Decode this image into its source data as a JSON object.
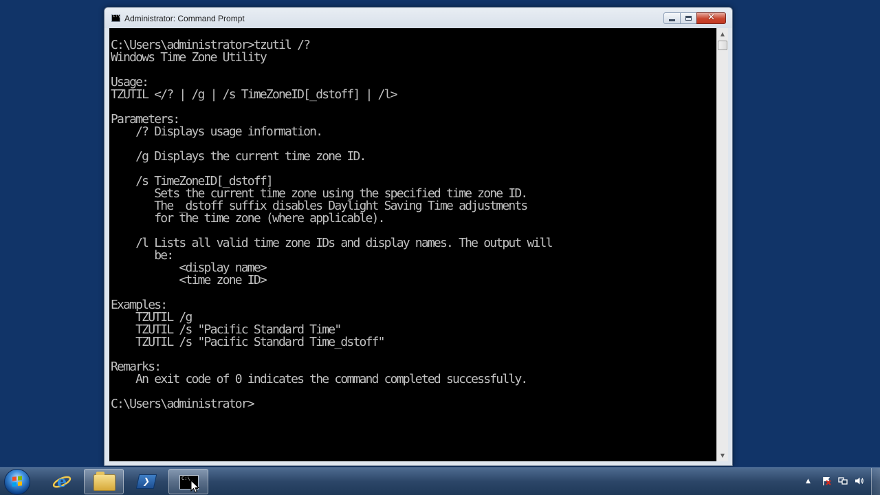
{
  "window": {
    "title": "Administrator: Command Prompt",
    "icon": "cmd-icon",
    "close_glyph": "✕"
  },
  "console": {
    "lines": [
      "C:\\Users\\administrator>tzutil /?",
      "Windows Time Zone Utility",
      "",
      "Usage:",
      "TZUTIL </? | /g | /s TimeZoneID[_dstoff] | /l>",
      "",
      "Parameters:",
      "    /? Displays usage information.",
      "",
      "    /g Displays the current time zone ID.",
      "",
      "    /s TimeZoneID[_dstoff]",
      "       Sets the current time zone using the specified time zone ID.",
      "       The _dstoff suffix disables Daylight Saving Time adjustments",
      "       for the time zone (where applicable).",
      "",
      "    /l Lists all valid time zone IDs and display names. The output will",
      "       be:",
      "           <display name>",
      "           <time zone ID>",
      "",
      "Examples:",
      "    TZUTIL /g",
      "    TZUTIL /s \"Pacific Standard Time\"",
      "    TZUTIL /s \"Pacific Standard Time_dstoff\"",
      "",
      "Remarks:",
      "    An exit code of 0 indicates the command completed successfully.",
      "",
      "C:\\Users\\administrator>"
    ]
  },
  "scrollbar": {
    "up_arrow": "▲",
    "down_arrow": "▼"
  },
  "taskbar": {
    "items": [
      {
        "icon": "start-orb-icon"
      },
      {
        "icon": "internet-explorer-icon"
      },
      {
        "icon": "file-explorer-icon"
      },
      {
        "icon": "powershell-icon",
        "glyph": "❯"
      },
      {
        "icon": "command-prompt-icon",
        "active": true
      }
    ],
    "tray": {
      "arrow": "▲",
      "icons": [
        "action-center-flag-icon",
        "network-icon",
        "volume-icon"
      ]
    }
  },
  "colors": {
    "desktop": "#113468",
    "console_bg": "#000000",
    "console_fg": "#c0c0c0",
    "close_button": "#c8452e"
  }
}
